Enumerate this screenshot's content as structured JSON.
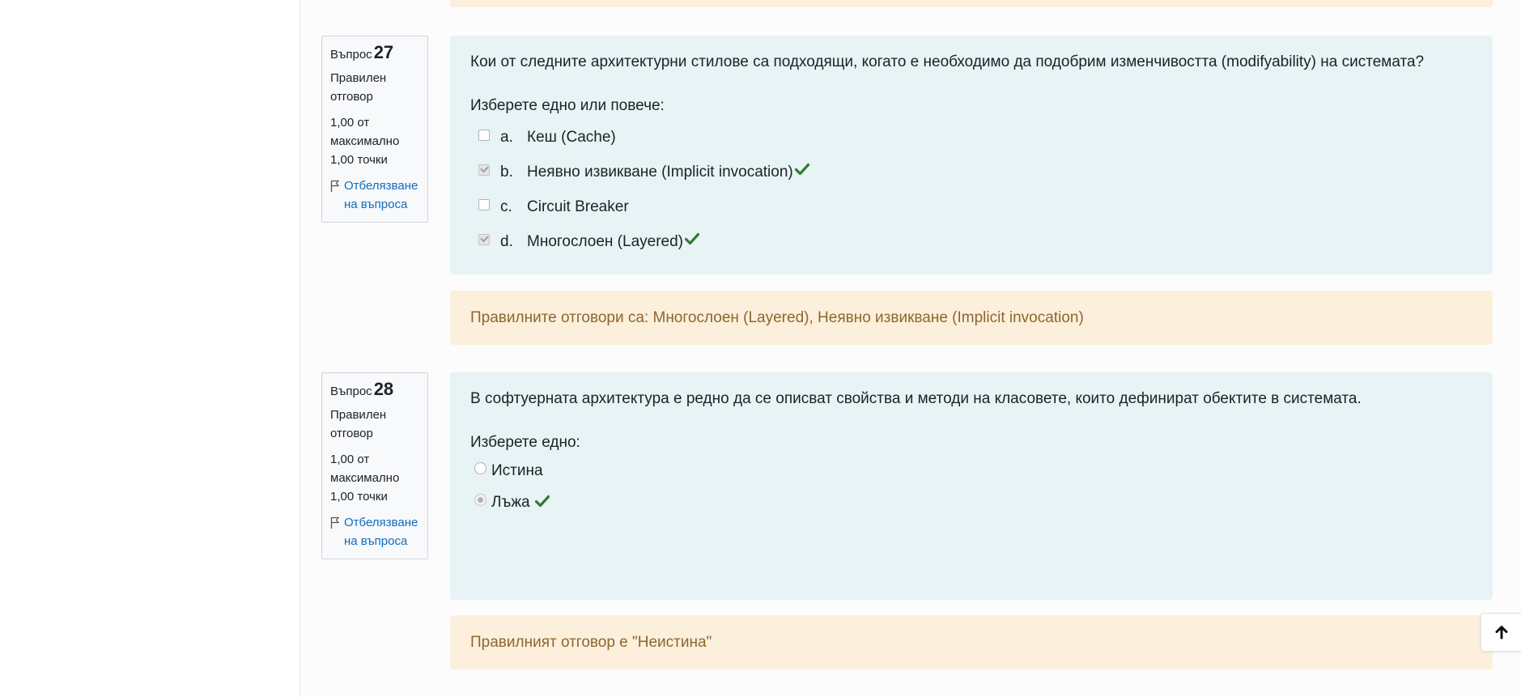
{
  "questions": [
    {
      "label": "Въпрос",
      "number": "27",
      "state": "Правилен отговор",
      "grade": "1,00 от максимално 1,00 точки",
      "flag_label": "Отбелязване на въпроса",
      "text": "Кои от следните архитектурни стилове са подходящи, когато е необходимо да подобрим изменчивостта (modifyability) на системата?",
      "prompt": "Изберете едно или повече:",
      "options": [
        {
          "letter": "a.",
          "text": "Кеш (Cache)",
          "checked": false,
          "correct": false
        },
        {
          "letter": "b.",
          "text": "Неявно извикване (Implicit invocation)",
          "checked": true,
          "correct": true
        },
        {
          "letter": "c.",
          "text": "Circuit Breaker",
          "checked": false,
          "correct": false
        },
        {
          "letter": "d.",
          "text": "Многослоен (Layered)",
          "checked": true,
          "correct": true
        }
      ],
      "feedback": "Правилните отговори са: Многослоен (Layered), Неявно извикване (Implicit invocation)"
    },
    {
      "label": "Въпрос",
      "number": "28",
      "state": "Правилен отговор",
      "grade": "1,00 от максимално 1,00 точки",
      "flag_label": "Отбелязване на въпроса",
      "text": "В софтуерната архитектура е редно да се описват свойства и методи на класовете, които дефинират обектите в системата.",
      "prompt": "Изберете едно:",
      "options": [
        {
          "text": "Истина",
          "checked": false,
          "correct": false
        },
        {
          "text": "Лъжа",
          "checked": true,
          "correct": true
        }
      ],
      "feedback": "Правилният отговор е \"Неистина\""
    }
  ],
  "icons": {
    "correct": "check-icon",
    "flag": "flag-icon",
    "back_to_top": "arrow-up-icon"
  },
  "colors": {
    "question_bg": "#e7f3f5",
    "feedback_bg": "#fcefdc",
    "feedback_text": "#8e662e",
    "correct_tick": "#357a32",
    "link": "#0f6cbf"
  }
}
